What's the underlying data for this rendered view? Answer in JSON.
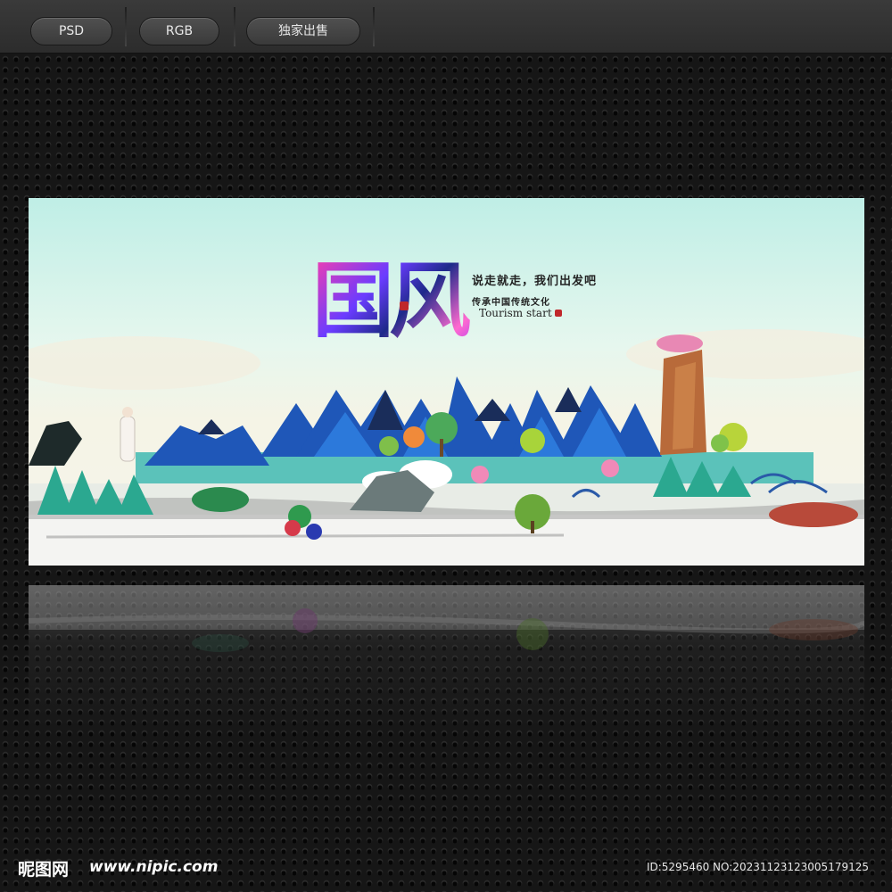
{
  "toolbar": {
    "buttons": [
      {
        "label": "PSD"
      },
      {
        "label": "RGB"
      },
      {
        "label": "独家出售"
      }
    ]
  },
  "poster": {
    "title": "国风",
    "slogan": "说走就走，我们出发吧",
    "subtitle": "传承中国传统文化",
    "english": "Tourism start"
  },
  "footer": {
    "logo": "昵图网",
    "url": "www.nipic.com",
    "id_text": "ID:5295460 NO:20231123123005179125"
  }
}
